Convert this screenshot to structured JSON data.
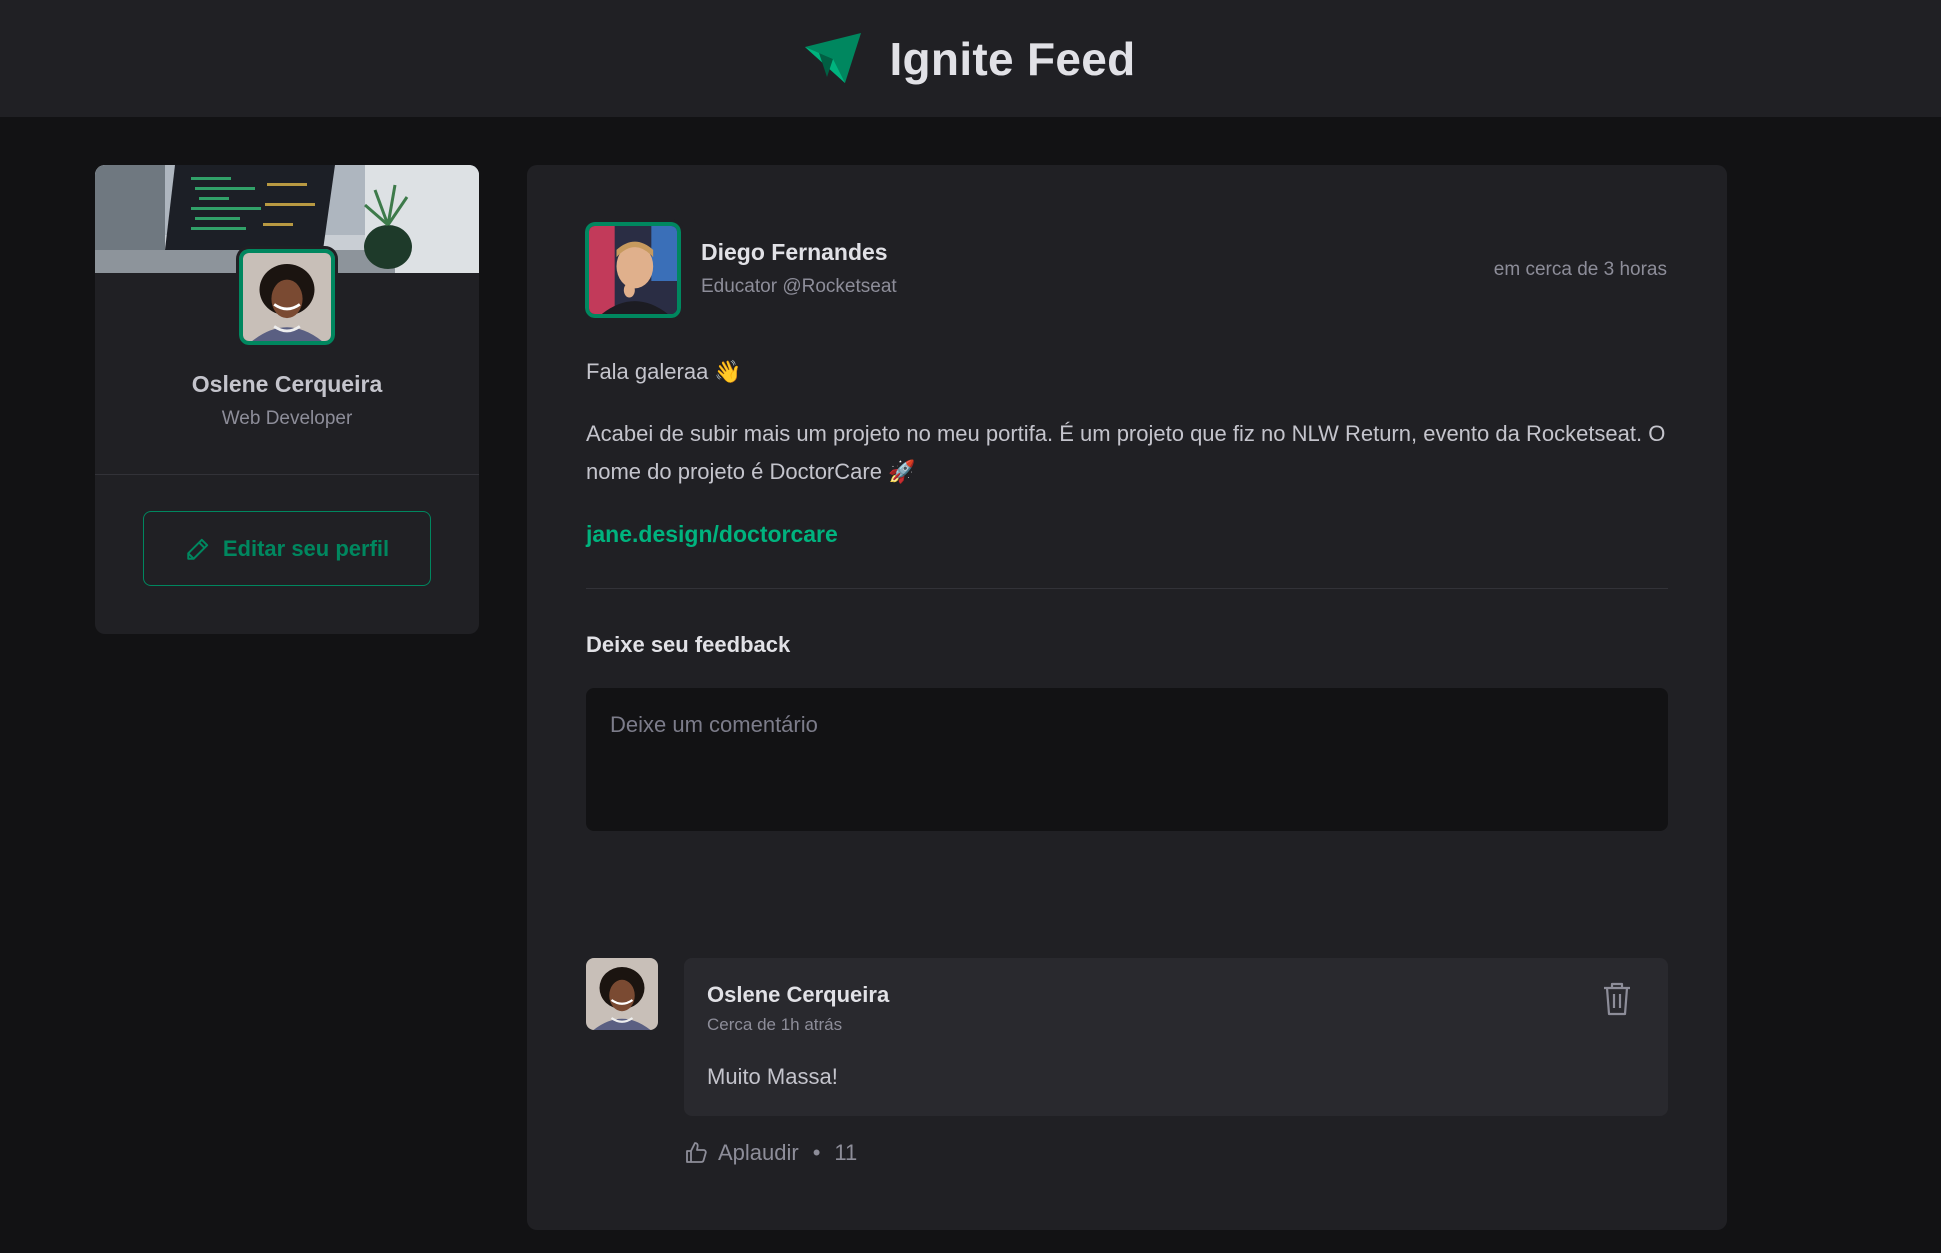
{
  "header": {
    "brand": "Ignite Feed",
    "logo_icon": "paper-plane-logo-icon"
  },
  "colors": {
    "accent": "#00875f",
    "accent_light": "#00b37e",
    "background": "#121214",
    "card": "#202024"
  },
  "sidebar": {
    "name": "Oslene Cerqueira",
    "role": "Web Developer",
    "edit_button": "Editar seu perfil",
    "edit_icon": "pencil-icon"
  },
  "post": {
    "author": {
      "name": "Diego Fernandes",
      "role": "Educator @Rocketseat"
    },
    "time": "em cerca de 3 horas",
    "paragraphs": [
      "Fala galeraa 👋",
      "Acabei de subir mais um projeto no meu portifa. É um projeto que fiz no NLW Return, evento da Rocketseat. O nome do projeto é DoctorCare 🚀"
    ],
    "link": "jane.design/doctorcare",
    "feedback_title": "Deixe seu feedback",
    "comment_placeholder": "Deixe um comentário"
  },
  "comment": {
    "author": "Oslene Cerqueira",
    "time": "Cerca de 1h atrás",
    "text": "Muito Massa!",
    "delete_icon": "trash-icon",
    "applaud_label": "Aplaudir",
    "applaud_separator": "•",
    "applaud_count": "11",
    "applaud_icon": "thumbs-up-icon"
  }
}
